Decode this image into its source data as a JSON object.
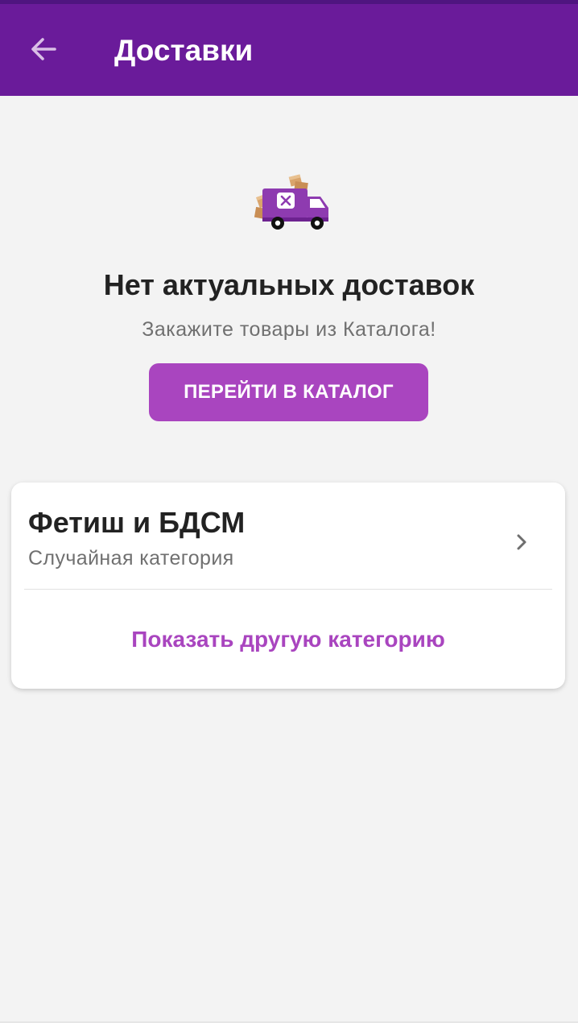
{
  "app_bar": {
    "title": "Доставки",
    "back_icon": "arrow-left-icon",
    "color": "#6a1b9a"
  },
  "empty_state": {
    "illustration": "delivery-truck-icon",
    "title": "Нет актуальных доставок",
    "subtitle": "Закажите товары из Каталога!",
    "button_label": "ПЕРЕЙТИ В КАТАЛОГ",
    "button_color": "#a945bf"
  },
  "category_card": {
    "title": "Фетиш и БДСМ",
    "subtitle": "Случайная категория",
    "chevron_icon": "chevron-right-icon",
    "action_label": "Показать другую категорию",
    "action_color": "#a945bf"
  },
  "colors": {
    "background": "#f3f3f3",
    "accent": "#a945bf",
    "truck": "#8e3bb0"
  }
}
